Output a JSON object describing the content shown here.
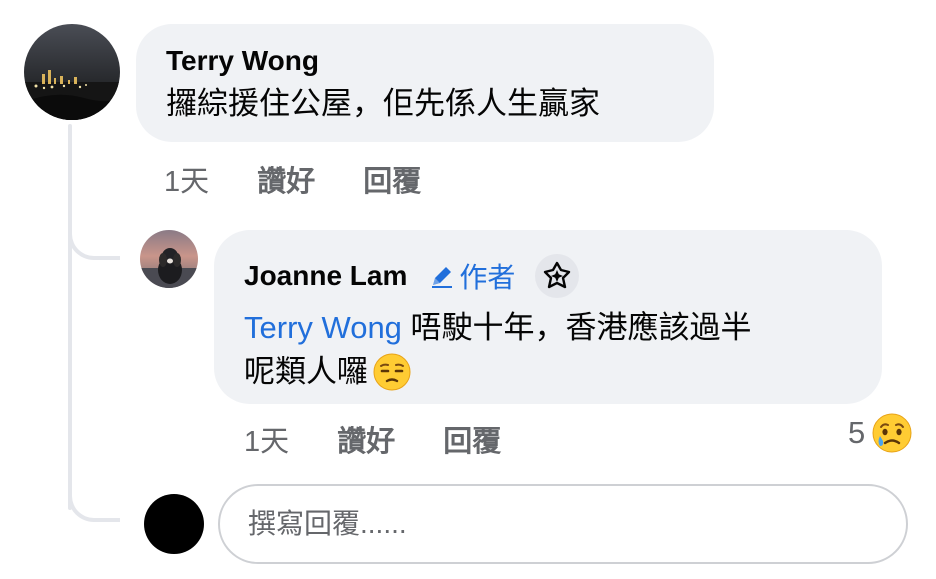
{
  "comment": {
    "author": "Terry Wong",
    "text": "攞綜援住公屋，佢先係人生贏家",
    "time": "1天",
    "like_label": "讚好",
    "reply_label": "回覆"
  },
  "reply": {
    "author": "Joanne Lam",
    "author_badge": "作者",
    "mention": "Terry Wong",
    "text_line1": " 唔駛十年，香港應該過半",
    "text_line2": "呢類人囉",
    "emoji": "unamused-face",
    "time": "1天",
    "like_label": "讚好",
    "reply_label": "回覆",
    "reaction_count": "5",
    "reaction_icon": "crying-face"
  },
  "composer": {
    "placeholder": "撰寫回覆......"
  },
  "colors": {
    "bubble": "#f0f2f5",
    "mention": "#216fdb",
    "meta": "#65676b",
    "thread_line": "#e4e6eb"
  }
}
